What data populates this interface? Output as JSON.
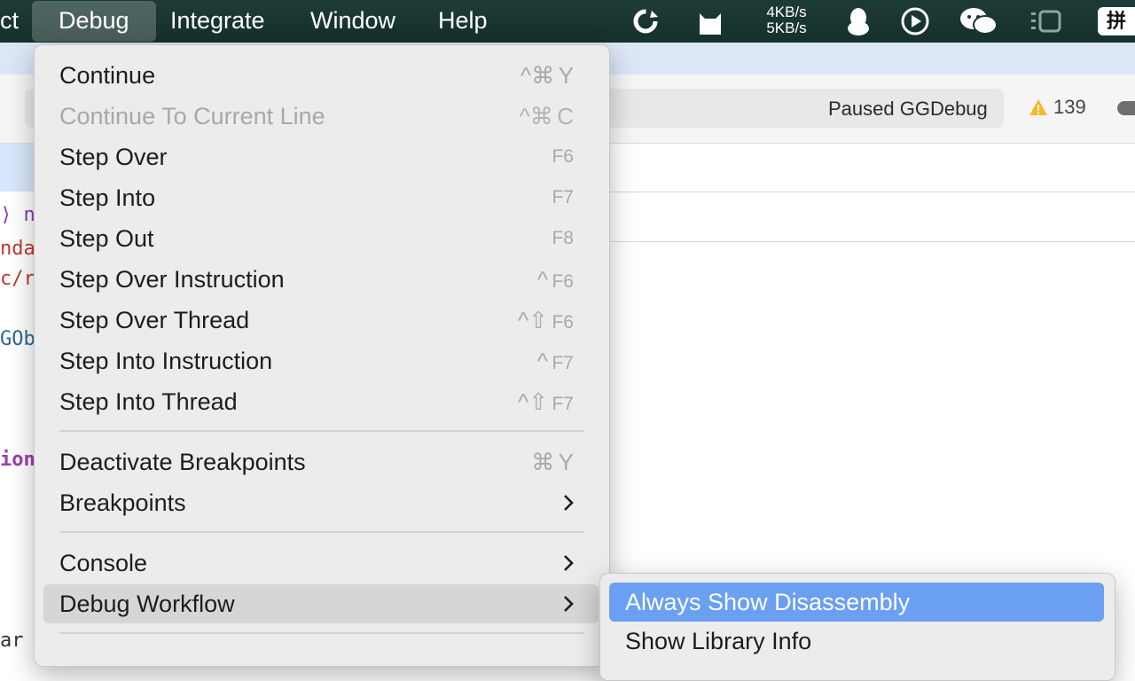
{
  "menubar": {
    "items": [
      "ct",
      "Debug",
      "Integrate",
      "Window",
      "Help"
    ],
    "active_item": "Debug",
    "net_up": "4KB/s",
    "net_down": "5KB/s",
    "ime": "拼"
  },
  "toolbar": {
    "status": "Paused GGDebug",
    "warning_count": "139",
    "warning_color": "#f5b82e"
  },
  "editor": {
    "code_fragments": [
      {
        "text": "⟩ n",
        "color": "#8a3ab9"
      },
      {
        "text": "nda",
        "color": "#c0392b"
      },
      {
        "text": "c/r",
        "color": "#c0392b"
      },
      {
        "text": "GOb",
        "color": "#2f6690"
      },
      {
        "text": "ion",
        "color": "#9b3fb0"
      },
      {
        "text": "ar",
        "color": "#333333"
      }
    ]
  },
  "debug_menu": {
    "items": [
      {
        "label": "Continue",
        "mod": "^⌘",
        "key": "Y",
        "enabled": true
      },
      {
        "label": "Continue To Current Line",
        "mod": "^⌘",
        "key": "C",
        "enabled": false
      },
      {
        "label": "Step Over",
        "mod": "",
        "key": "F6",
        "enabled": true
      },
      {
        "label": "Step Into",
        "mod": "",
        "key": "F7",
        "enabled": true
      },
      {
        "label": "Step Out",
        "mod": "",
        "key": "F8",
        "enabled": true
      },
      {
        "label": "Step Over Instruction",
        "mod": "^",
        "key": "F6",
        "enabled": true
      },
      {
        "label": "Step Over Thread",
        "mod": "^⇧",
        "key": "F6",
        "enabled": true
      },
      {
        "label": "Step Into Instruction",
        "mod": "^",
        "key": "F7",
        "enabled": true
      },
      {
        "label": "Step Into Thread",
        "mod": "^⇧",
        "key": "F7",
        "enabled": true
      },
      {
        "label": "Deactivate Breakpoints",
        "mod": "⌘",
        "key": "Y",
        "enabled": true
      },
      {
        "label": "Breakpoints",
        "submenu": true,
        "enabled": true
      },
      {
        "label": "Console",
        "submenu": true,
        "enabled": true
      },
      {
        "label": "Debug Workflow",
        "submenu": true,
        "enabled": true,
        "highlighted": true
      }
    ]
  },
  "debug_workflow_submenu": {
    "items": [
      {
        "label": "Always Show Disassembly",
        "selected": true
      },
      {
        "label": "Show Library Info",
        "selected": false
      }
    ],
    "selected_color": "#6a9ff2"
  }
}
